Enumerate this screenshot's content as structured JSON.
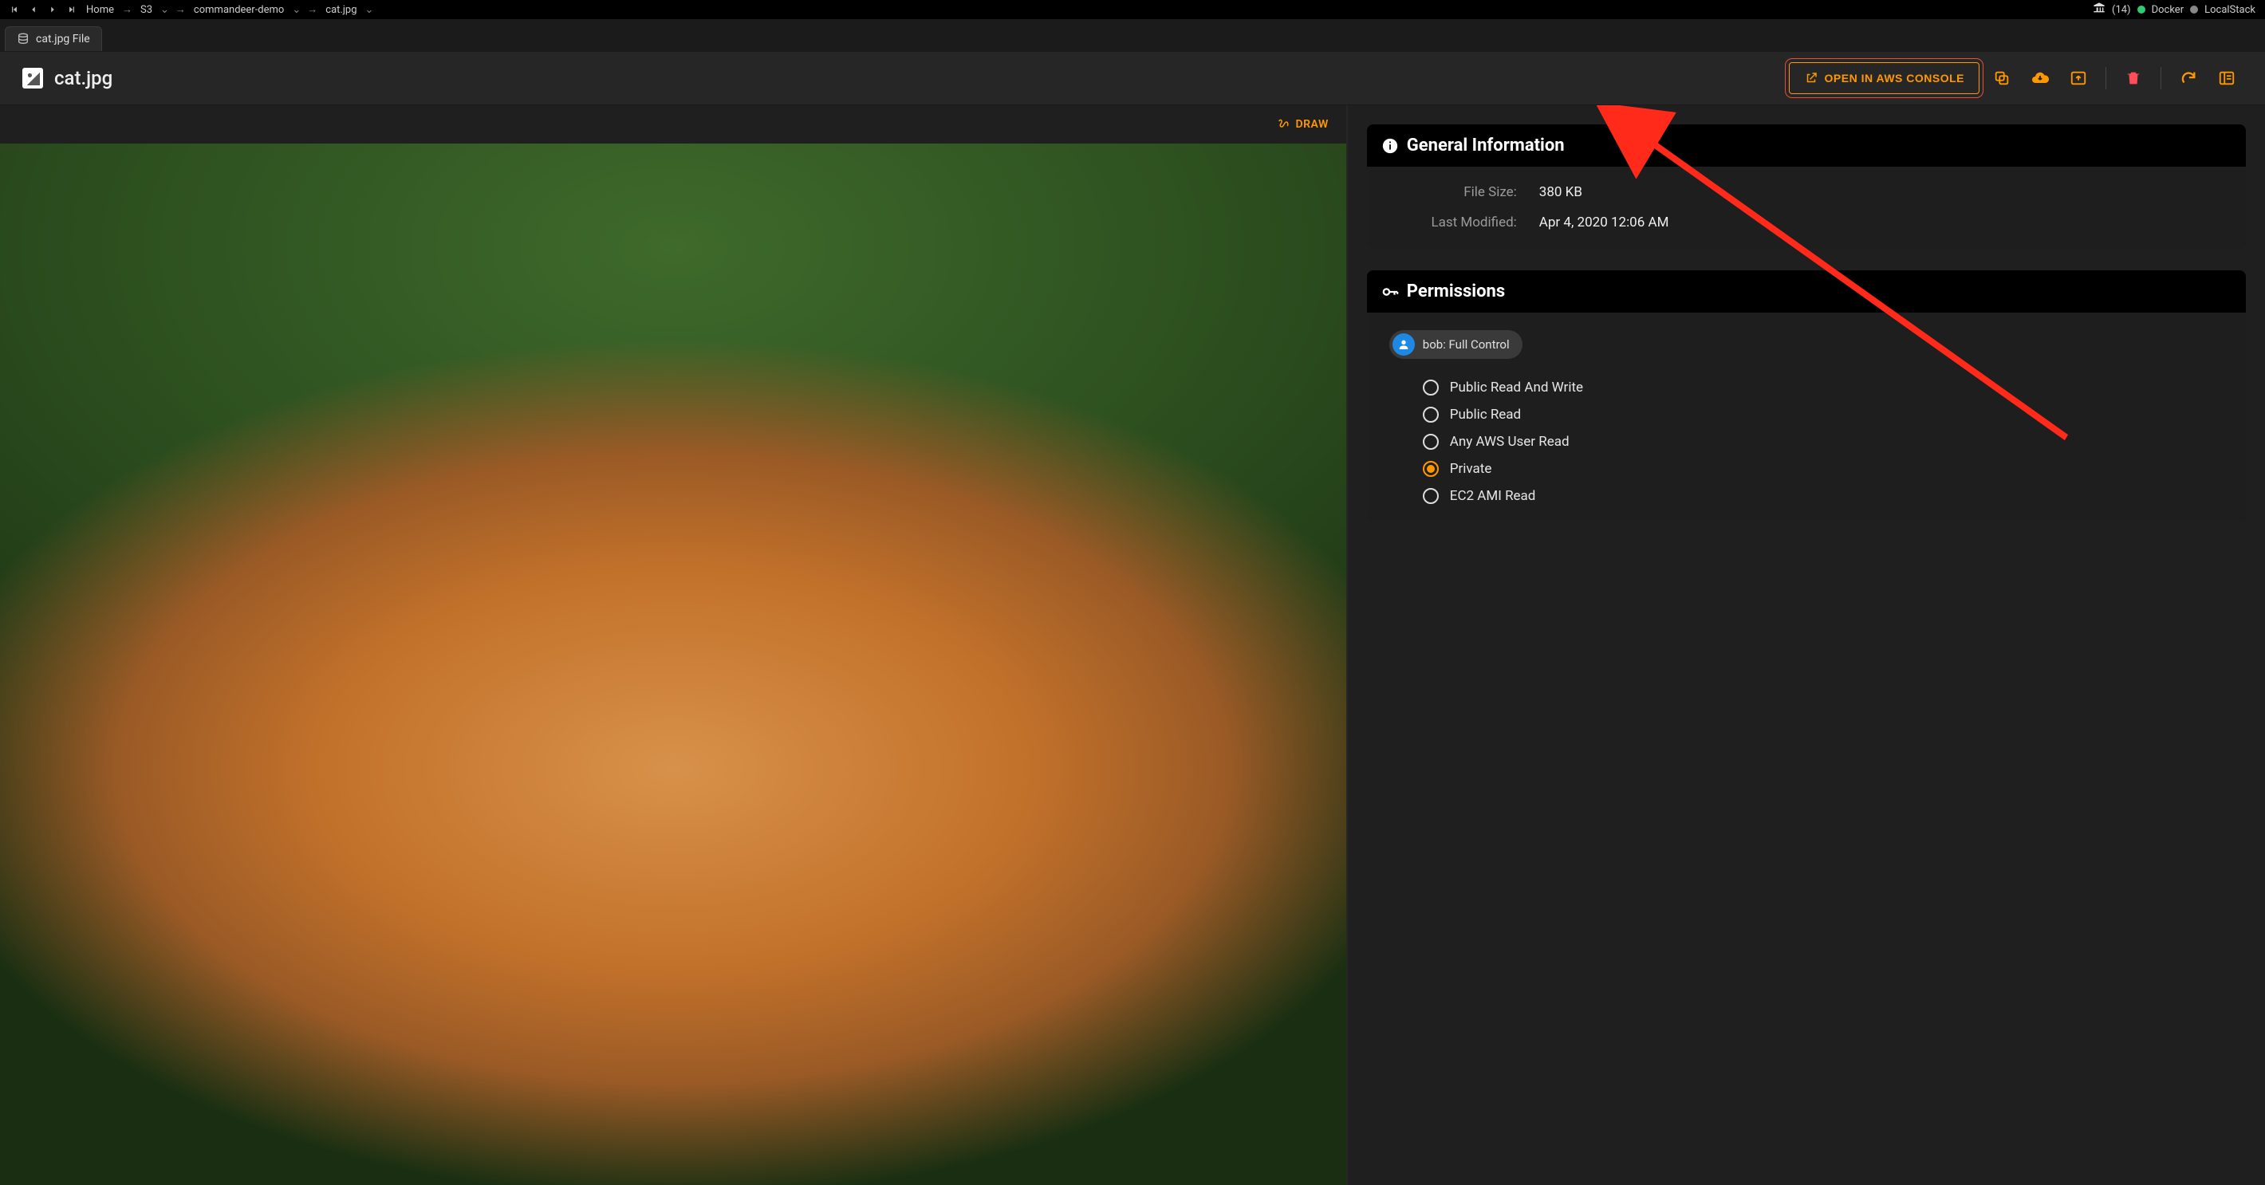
{
  "breadcrumb": {
    "home": "Home",
    "s3": "S3",
    "bucket": "commandeer-demo",
    "file": "cat.jpg"
  },
  "topright": {
    "bank_count": "(14)",
    "docker": "Docker",
    "localstack": "LocalStack"
  },
  "tab": {
    "label": "cat.jpg File"
  },
  "page": {
    "title": "cat.jpg",
    "open_aws": "OPEN IN AWS CONSOLE",
    "draw": "DRAW"
  },
  "general": {
    "title": "General Information",
    "file_size_label": "File Size:",
    "file_size_value": "380 KB",
    "last_modified_label": "Last Modified:",
    "last_modified_value": "Apr 4, 2020 12:06 AM"
  },
  "permissions": {
    "title": "Permissions",
    "owner_chip": "bob: Full Control",
    "options": [
      {
        "label": "Public Read And Write",
        "selected": false
      },
      {
        "label": "Public Read",
        "selected": false
      },
      {
        "label": "Any AWS User Read",
        "selected": false
      },
      {
        "label": "Private",
        "selected": true
      },
      {
        "label": "EC2 AMI Read",
        "selected": false
      }
    ]
  }
}
